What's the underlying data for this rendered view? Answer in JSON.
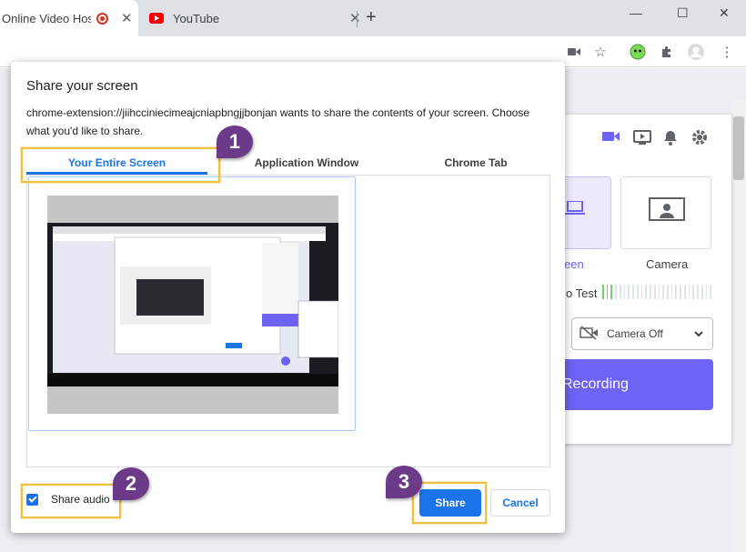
{
  "browser": {
    "tabs": [
      {
        "title": "Online Video Hosti",
        "state": "active",
        "indicator": "recording-icon"
      },
      {
        "title": "YouTube",
        "state": "inactive",
        "icon": "youtube-icon"
      }
    ],
    "new_tab": "+",
    "window_controls": {
      "minimize": "—",
      "maximize": "☐",
      "close": "✕"
    }
  },
  "background_panel": {
    "options": [
      {
        "label": "een",
        "state": "selected",
        "icon": "laptop-icon"
      },
      {
        "label": "Camera",
        "state": "unselected",
        "icon": "camera-icon"
      }
    ],
    "test_label": "o Test",
    "camera_select": "Camera Off",
    "record_button": "Recording",
    "accent_color": "#6d63f5"
  },
  "dialog": {
    "title": "Share your screen",
    "message": "chrome-extension://jiihcciniecimeajcniapbngjjbonjan wants to share the contents of your screen. Choose what you'd like to share.",
    "tabs": [
      {
        "label": "Your Entire Screen",
        "selected": true
      },
      {
        "label": "Application Window",
        "selected": false
      },
      {
        "label": "Chrome Tab",
        "selected": false
      }
    ],
    "share_audio": {
      "label": "Share audio",
      "checked": true
    },
    "share_button": "Share",
    "cancel_button": "Cancel",
    "accent_color": "#1a73e8"
  },
  "annotations": {
    "callouts": [
      "1",
      "2",
      "3"
    ],
    "highlight_color": "#f0c040",
    "callout_color": "#6b3a88"
  }
}
